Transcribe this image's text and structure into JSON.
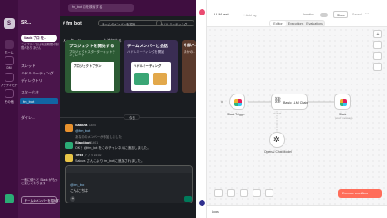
{
  "slack": {
    "workspace_initial": "S",
    "workspace_name": "SR...",
    "nav_back": "←",
    "nav_forward": "→",
    "channel_title": "# fm_bot",
    "search_placeholder": "fm_bot 内を検索する",
    "add_member_label": "チームのメンバーを招待",
    "huddle_label": "ハドルミーティング",
    "rail": [
      {
        "label": "ホーム"
      },
      {
        "label": "DM"
      },
      {
        "label": "アクティビティ"
      },
      {
        "label": "その他"
      }
    ],
    "sidebar": {
      "upgrade_label": "Slack プロ を...",
      "promo_text": "このプランでは利用期間の制限がありません",
      "items": [
        {
          "label": "スレッド"
        },
        {
          "label": "ハドルミーティング"
        },
        {
          "label": "ディレクトリ"
        },
        {
          "label": "スター付き"
        },
        {
          "label": "チャンネル"
        },
        {
          "label": "fm_bot"
        },
        {
          "label": "ダイレ..."
        }
      ],
      "footer_text": "一緒に使うと Slack がもっと楽しくなります",
      "invite_button": "チームのメンバーを招待する"
    },
    "tabs": [
      {
        "label": "メッセージ"
      },
      {
        "label": "canvas を追加する"
      }
    ],
    "cards": [
      {
        "title": "プロジェクトを開始する",
        "text": "プロジェクトスターターキットテンプレート",
        "inner": "プロジェクトプラン"
      },
      {
        "title": "チームメンバーと会話",
        "text": "ハドルミーティングを開始",
        "inner": "ハドルミーティング"
      },
      {
        "title": "外部パ...",
        "text": "ほかの..."
      }
    ],
    "date_divider": "今日",
    "messages": [
      {
        "name": "Sakura",
        "time": "14:00",
        "text": "@fm_bot"
      },
      {
        "name": "",
        "time": "",
        "text": "あなたのメンバーが参加しました"
      },
      {
        "name": "Slackbot",
        "time": "14:01",
        "text": "OK！ @fm_bot をこのチャンネルに追加しました。"
      },
      {
        "name": "Test",
        "time": "アプリ 14:02",
        "text": "Sakura さんにより fm_bot に追加されました。"
      }
    ],
    "composer": {
      "line1": "@fm_bot",
      "line2": "こんにちは"
    }
  },
  "n8n": {
    "workflow_name": "LLM-test",
    "add_tag": "+ Add tag",
    "inactive_label": "Inactive",
    "share_label": "Share",
    "saved_label": "Saved",
    "tabs": [
      {
        "label": "Editor"
      },
      {
        "label": "Executions"
      },
      {
        "label": "Evaluations"
      }
    ],
    "nodes": {
      "trigger": {
        "title": "Slack Trigger",
        "icon": "slack-icon"
      },
      "chain": {
        "title": "Basic LLM Chain",
        "icon": "link-icon"
      },
      "model": {
        "title": "OpenAI Chat Model",
        "icon": "openai-icon"
      },
      "output": {
        "title": "Slack",
        "subtitle": "post: message",
        "icon": "slack-icon"
      }
    },
    "model_port_label": "Model*",
    "execute_button": "Execute workflow",
    "logs_label": "Logs",
    "accent_color": "#ff6d5a"
  }
}
